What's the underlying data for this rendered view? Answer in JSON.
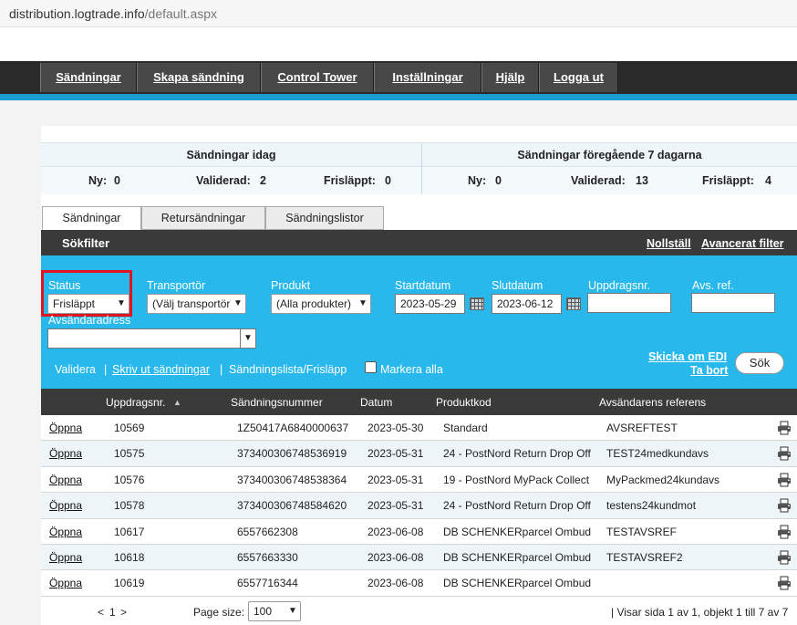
{
  "browser": {
    "host": "distribution.logtrade.info",
    "path": "/default.aspx"
  },
  "nav": [
    {
      "label": "Sändningar"
    },
    {
      "label": "Skapa sändning"
    },
    {
      "label": "Control Tower"
    },
    {
      "label": "Inställningar"
    },
    {
      "label": "Hjälp"
    },
    {
      "label": "Logga ut"
    }
  ],
  "summary": {
    "today": {
      "title": "Sändningar idag",
      "ny_label": "Ny:",
      "ny": "0",
      "validerad_label": "Validerad:",
      "validerad": "2",
      "frislappt_label": "Frisläppt:",
      "frislappt": "0"
    },
    "last7": {
      "title": "Sändningar föregående 7 dagarna",
      "ny_label": "Ny:",
      "ny": "0",
      "validerad_label": "Validerad:",
      "validerad": "13",
      "frislappt_label": "Frisläppt:",
      "frislappt": "4"
    }
  },
  "tabs": [
    {
      "label": "Sändningar"
    },
    {
      "label": "Retursändningar"
    },
    {
      "label": "Sändningslistor"
    }
  ],
  "filter": {
    "title": "Sökfilter",
    "reset": "Nollställ",
    "advanced": "Avancerat filter",
    "status_label": "Status",
    "status_value": "Frisläppt",
    "transporter_label": "Transportör",
    "transporter_value": "(Välj transportör)",
    "product_label": "Produkt",
    "product_value": "(Alla produkter)",
    "start_label": "Startdatum",
    "start_value": "2023-05-29",
    "end_label": "Slutdatum",
    "end_value": "2023-06-12",
    "uppdrag_label": "Uppdragsnr.",
    "avsref_label": "Avs. ref.",
    "avsadr_label": "Avsändaradress",
    "validera": "Validera",
    "skriv_ut": "Skriv ut sändningar",
    "sandningslista": "Sändningslista/Frisläpp",
    "markera_alla": "Markera alla",
    "skicka_om": "Skicka om EDI",
    "ta_bort": "Ta bort",
    "sok": "Sök",
    "sep": "|"
  },
  "table": {
    "headers": {
      "uppdrag": "Uppdragsnr.",
      "sort_arrow": "▲",
      "sandning": "Sändningsnummer",
      "datum": "Datum",
      "produkt": "Produktkod",
      "ref": "Avsändarens referens"
    },
    "open_label": "Öppna",
    "rows": [
      {
        "uppdrag": "10569",
        "sandning": "1Z50417A6840000637",
        "datum": "2023-05-30",
        "produkt": "Standard",
        "ref": "AVSREFTEST"
      },
      {
        "uppdrag": "10575",
        "sandning": "373400306748536919",
        "datum": "2023-05-31",
        "produkt": "24 - PostNord Return Drop Off",
        "ref": "TEST24medkundavs"
      },
      {
        "uppdrag": "10576",
        "sandning": "373400306748538364",
        "datum": "2023-05-31",
        "produkt": "19 - PostNord MyPack Collect",
        "ref": "MyPackmed24kundavs"
      },
      {
        "uppdrag": "10578",
        "sandning": "373400306748584620",
        "datum": "2023-05-31",
        "produkt": "24 - PostNord Return Drop Off",
        "ref": "testens24kundmot"
      },
      {
        "uppdrag": "10617",
        "sandning": "6557662308",
        "datum": "2023-06-08",
        "produkt": "DB SCHENKERparcel Ombud",
        "ref": "TESTAVSREF"
      },
      {
        "uppdrag": "10618",
        "sandning": "6557663330",
        "datum": "2023-06-08",
        "produkt": "DB SCHENKERparcel Ombud",
        "ref": "TESTAVSREF2"
      },
      {
        "uppdrag": "10619",
        "sandning": "6557716344",
        "datum": "2023-06-08",
        "produkt": "DB SCHENKERparcel Ombud",
        "ref": ""
      }
    ]
  },
  "pager": {
    "prev": "<",
    "page": "1",
    "next": ">",
    "size_label": "Page size:",
    "size_value": "100",
    "info": "| Visar sida 1 av 1, objekt 1 till 7 av 7"
  }
}
